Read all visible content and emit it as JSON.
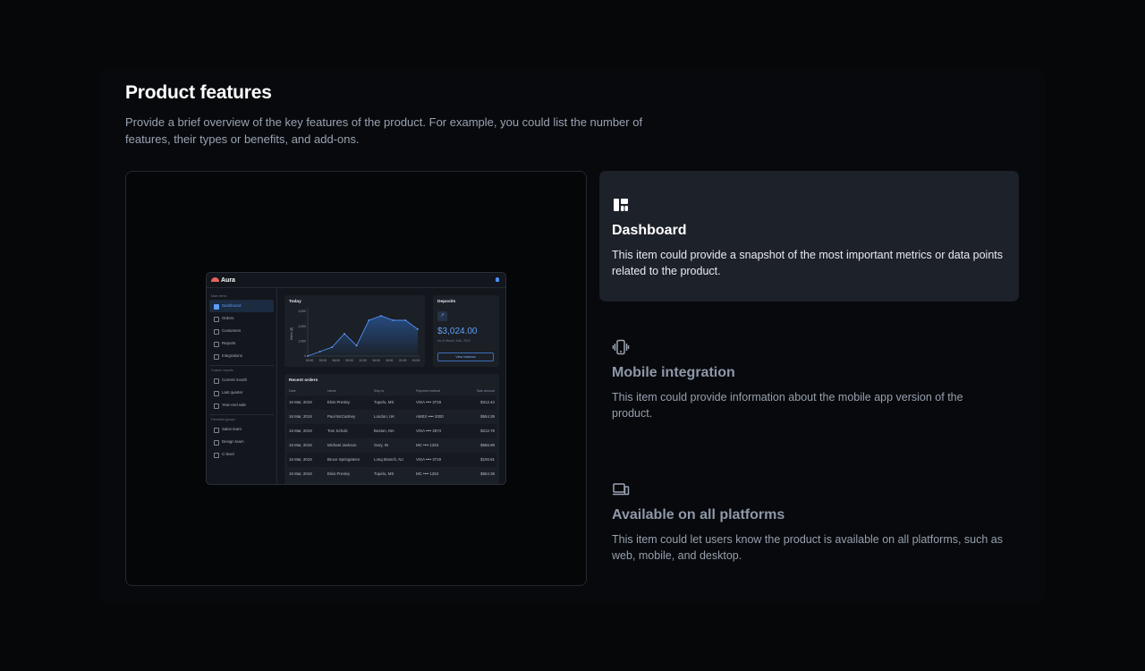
{
  "section": {
    "title": "Product features",
    "description": "Provide a brief overview of the key features of the product. For example, you could list the number of features, their types or benefits, and add-ons."
  },
  "features": [
    {
      "icon": "dashboard-icon",
      "title": "Dashboard",
      "description": "This item could provide a snapshot of the most important metrics or data points related to the product.",
      "active": true
    },
    {
      "icon": "mobile-vibrate-icon",
      "title": "Mobile integration",
      "description": "This item could provide information about the mobile app version of the product.",
      "active": false
    },
    {
      "icon": "devices-icon",
      "title": "Available on all platforms",
      "description": "This item could let users know the product is available on all platforms, such as web, mobile, and desktop.",
      "active": false
    }
  ],
  "app": {
    "brand": "Aura",
    "groups": [
      {
        "label": "Main items",
        "items": [
          "Dashboard",
          "Orders",
          "Customers",
          "Reports",
          "Integrations"
        ]
      },
      {
        "label": "Custom reports",
        "items": [
          "Current month",
          "Last quarter",
          "Year-end sale"
        ]
      },
      {
        "label": "Favorited groups",
        "items": [
          "Sales team",
          "Design team",
          "C-level"
        ]
      }
    ],
    "selected_item": "Dashboard",
    "today": {
      "title": "Today",
      "ylabel": "Sales ($)",
      "y_ticks": [
        "0",
        "1,000",
        "2,000",
        "3,000"
      ],
      "x_ticks": [
        "00:00",
        "03:00",
        "06:00",
        "09:00",
        "12:00",
        "15:00",
        "18:00",
        "21:00",
        "24:00"
      ]
    },
    "deposits": {
      "title": "Deposits",
      "amount": "$3,024.00",
      "date": "As of March 14th, 2022",
      "button": "View balance"
    },
    "orders": {
      "title": "Recent orders",
      "columns": [
        "Date",
        "Name",
        "Ship to",
        "Payment method",
        "Sale amount"
      ],
      "rows": [
        [
          "16 Mar, 2019",
          "Elvis Presley",
          "Tupelo, MS",
          "VISA  •••• 3719",
          "$312.44"
        ],
        [
          "16 Mar, 2019",
          "Paul McCartney",
          "London, UK",
          "AMEX  •••• 2000",
          "$654.39"
        ],
        [
          "16 Mar, 2019",
          "Tom Scholz",
          "Boston, MA",
          "VISA  •••• 2574",
          "$212.79"
        ],
        [
          "16 Mar, 2019",
          "Michael Jackson",
          "Gary, IN",
          "MC  •••• 1253",
          "$666.99"
        ],
        [
          "16 Mar, 2019",
          "Bruce Springsteen",
          "Long Branch, NJ",
          "VISA  •••• 3719",
          "$100.81"
        ],
        [
          "16 Mar, 2019",
          "Elvis Presley",
          "Tupelo, MS",
          "MC  •••• 1253",
          "$654.39"
        ]
      ]
    }
  },
  "chart_data": {
    "type": "area",
    "title": "Today",
    "ylabel": "Sales ($)",
    "x": [
      "00:00",
      "03:00",
      "06:00",
      "09:00",
      "12:00",
      "15:00",
      "18:00",
      "21:00",
      "24:00"
    ],
    "series": [
      {
        "values": [
          0,
          300,
          600,
          1500,
          700,
          2400,
          2700,
          2400,
          2400,
          1800
        ]
      }
    ],
    "ylim": [
      0,
      3000
    ]
  },
  "colors": {
    "accent": "#5e9cf7",
    "panel": "#1d2129",
    "background": "#060709"
  }
}
